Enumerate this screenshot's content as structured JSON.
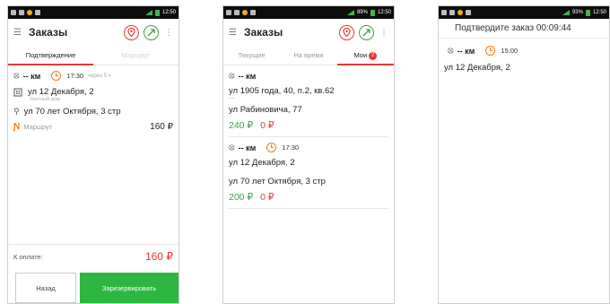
{
  "status": {
    "time_p1": "12:50",
    "time_p2": "12:50",
    "time_p3": "12:50",
    "battery_p2": "89%",
    "battery_p3": "93%"
  },
  "screen1": {
    "title": "Заказы",
    "tabs": [
      "Подтверждение",
      "Маршрут"
    ],
    "order": {
      "km": "-- км",
      "time": "17:30",
      "in": "через 5 ч",
      "from": "ул 12 Декабря, 2",
      "from_sub": "Частный дом",
      "to": "ул 70 лет Октября, 3 стр",
      "route_label": "Маршрут",
      "price": "160 ₽"
    },
    "pay_label": "К оплате:",
    "pay_value": "160 ₽",
    "back_label": "Назад",
    "book_label": "Зарезервировать"
  },
  "screen2": {
    "title": "Заказы",
    "tabs": [
      "Текущие",
      "На время",
      "Мои"
    ],
    "my_count": "2",
    "orders": [
      {
        "km": "-- км",
        "time": "",
        "from": "ул 1905 года, 40, п.2, кв.62",
        "from_sub": "---",
        "to": "ул Рабиновича, 77",
        "price": "240 ₽",
        "extra": "0 ₽"
      },
      {
        "km": "-- км",
        "time": "17:30",
        "from": "ул 12 Декабря, 2",
        "from_sub": "",
        "to": "ул 70 лет Октября, 3 стр",
        "price": "200 ₽",
        "extra": "0 ₽"
      }
    ]
  },
  "screen3": {
    "confirm": "Подтвердите заказ 00:09:44",
    "km": "-- км",
    "time": "15:00",
    "address": "ул 12 Декабря, 2"
  },
  "colors": {
    "accent_red": "#e53935",
    "accent_green": "#43a047",
    "clock_orange": "#ff7a00",
    "button_green": "#2db742"
  }
}
